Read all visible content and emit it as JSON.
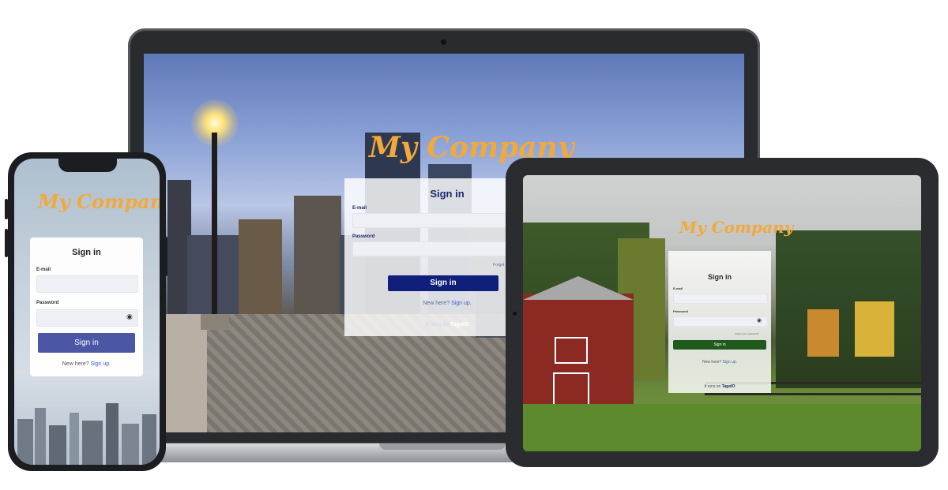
{
  "brand": {
    "name": "My Company",
    "color": "#f2a93b"
  },
  "laptop": {
    "title": "Sign in",
    "email_label": "E-mail",
    "password_label": "Password",
    "forgot_label": "Forgot",
    "signin_label": "Sign in",
    "new_here": "New here?",
    "sign_up": "Sign up.",
    "runs_on": "It runs on",
    "tago": "TagoIO",
    "button_color": "#0f1f7a"
  },
  "phone": {
    "title": "Sign in",
    "email_label": "E-mail",
    "password_label": "Password",
    "signin_label": "Sign in",
    "new_here": "New here?",
    "sign_up": "Sign up.",
    "button_color": "#4b57a5"
  },
  "tablet": {
    "title": "Sign in",
    "email_label": "E-mail",
    "password_label": "Password",
    "forgot_label": "Forgot your password?",
    "signin_label": "Sign in",
    "new_here": "New here?",
    "sign_up": "Sign up.",
    "runs_on": "It runs on",
    "tago": "TagoIO",
    "button_color": "#1f5a1c"
  }
}
